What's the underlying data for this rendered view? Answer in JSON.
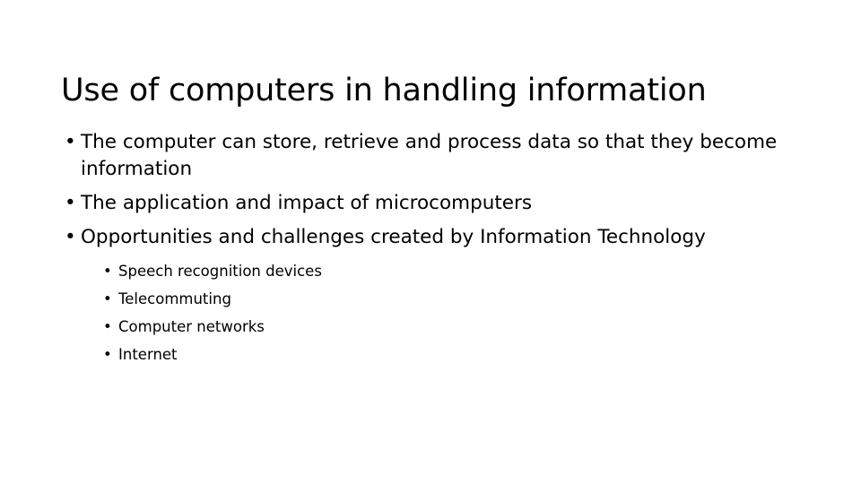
{
  "slide": {
    "title": "Use of computers in handling information",
    "bullet_glyph": "•",
    "text_color": "#000000",
    "background_color": "#ffffff",
    "bullets": [
      {
        "text": "The computer can store, retrieve and process data so that they become information"
      },
      {
        "text": "The application and impact of microcomputers"
      },
      {
        "text": "Opportunities and challenges created by Information Technology",
        "sub_bullets": [
          {
            "text": "Speech recognition devices"
          },
          {
            "text": "Telecommuting"
          },
          {
            "text": "Computer networks"
          },
          {
            "text": "Internet"
          }
        ]
      }
    ]
  }
}
